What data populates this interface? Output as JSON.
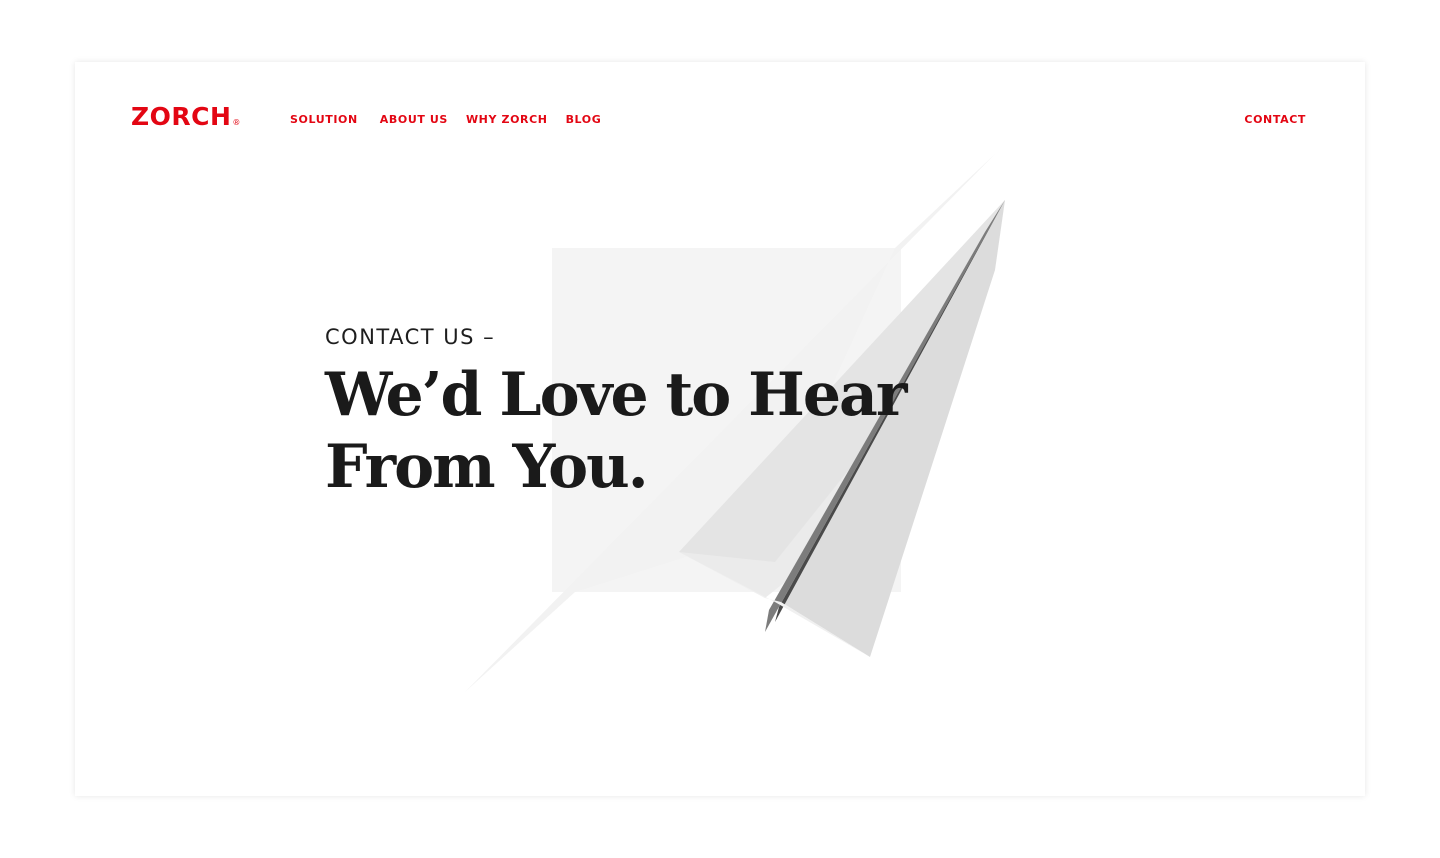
{
  "brand": {
    "logo_text": "ZORCH",
    "logo_mark": "®",
    "accent_color": "#e30613"
  },
  "nav": {
    "items": [
      {
        "label": "SOLUTION"
      },
      {
        "label": "ABOUT US"
      },
      {
        "label": "WHY ZORCH"
      },
      {
        "label": "BLOG"
      }
    ],
    "contact_label": "CONTACT"
  },
  "hero": {
    "eyebrow": "CONTACT US –",
    "headline_line1": "We’d Love to Hear",
    "headline_line2": "From You.",
    "illustration": "paper-airplane-icon"
  }
}
